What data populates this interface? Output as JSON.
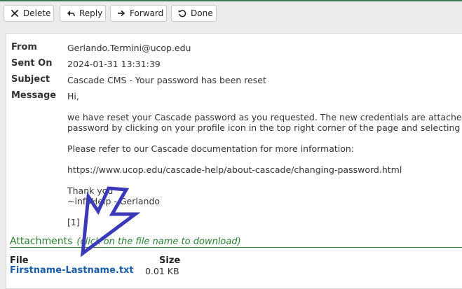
{
  "toolbar": {
    "delete_label": "Delete",
    "reply_label": "Reply",
    "forward_label": "Forward",
    "done_label": "Done"
  },
  "message": {
    "from_label": "From",
    "from_value": "Gerlando.Termini@ucop.edu",
    "sent_label": "Sent On",
    "sent_value": "2024-01-31 13:31:39",
    "subject_label": "Subject",
    "subject_value": "Cascade CMS - Your password has been reset",
    "body_label": "Message",
    "body_lines": [
      "Hi,",
      "we have reset your Cascade password as you requested. The new credentials are attached he",
      "password by clicking on your profile icon in the top right corner of the page and selecting Set",
      "Please refer to our Cascade documentation for more information:",
      "https://www.ucop.edu/cascade-help/about-cascade/changing-password.html",
      "Thank you",
      "~infoHelp - Gerlando",
      "[1]"
    ]
  },
  "attachments": {
    "title": "Attachments",
    "hint": "(click on the file name to download)",
    "col_file": "File",
    "col_size": "Size",
    "files": [
      {
        "name": "Firstname-Lastname.txt",
        "size": "0.01 KB"
      }
    ]
  },
  "colors": {
    "accent_green": "#2e7d32",
    "link_blue": "#1a5ea8",
    "arrow_blue": "#3a3ab8"
  },
  "icons": {
    "delete": "x-icon",
    "reply": "reply-arrow-icon",
    "forward": "forward-arrow-icon",
    "done": "undo-circle-icon",
    "annotation": "arrow-pointer-annotation"
  }
}
